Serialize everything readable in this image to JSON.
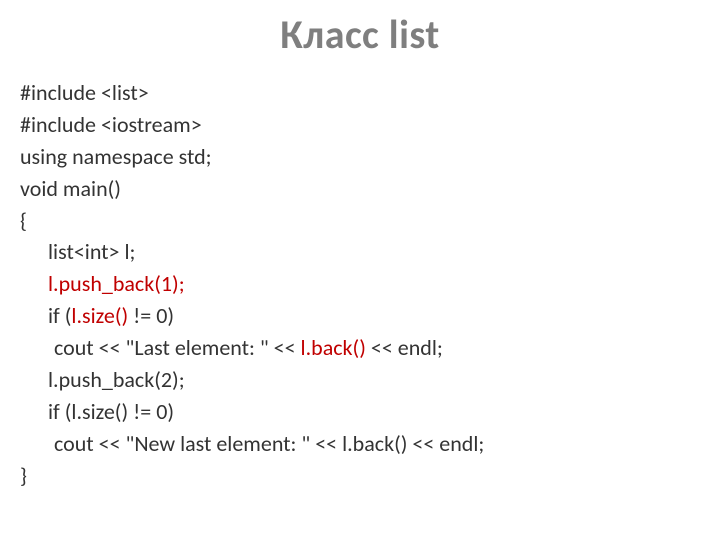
{
  "title": "Класс list",
  "code": {
    "line1": "#include <list>",
    "line2": "#include <iostream>",
    "line3": "using namespace std;",
    "line4": "void main()",
    "line5": "{",
    "line6": "list<int> l;",
    "line7_red": "l.push_back(1);",
    "line8_a": "if (",
    "line8_red": "l.size()",
    "line8_b": " != 0)",
    "line9_a": "cout << \"Last element: \" << ",
    "line9_red": "l.back()",
    "line9_b": " << endl;",
    "line10": "l.push_back(2);",
    "line11": "if (l.size() != 0)",
    "line12": "cout << \"New last element: \" << l.back() << endl;",
    "line13": "}"
  }
}
